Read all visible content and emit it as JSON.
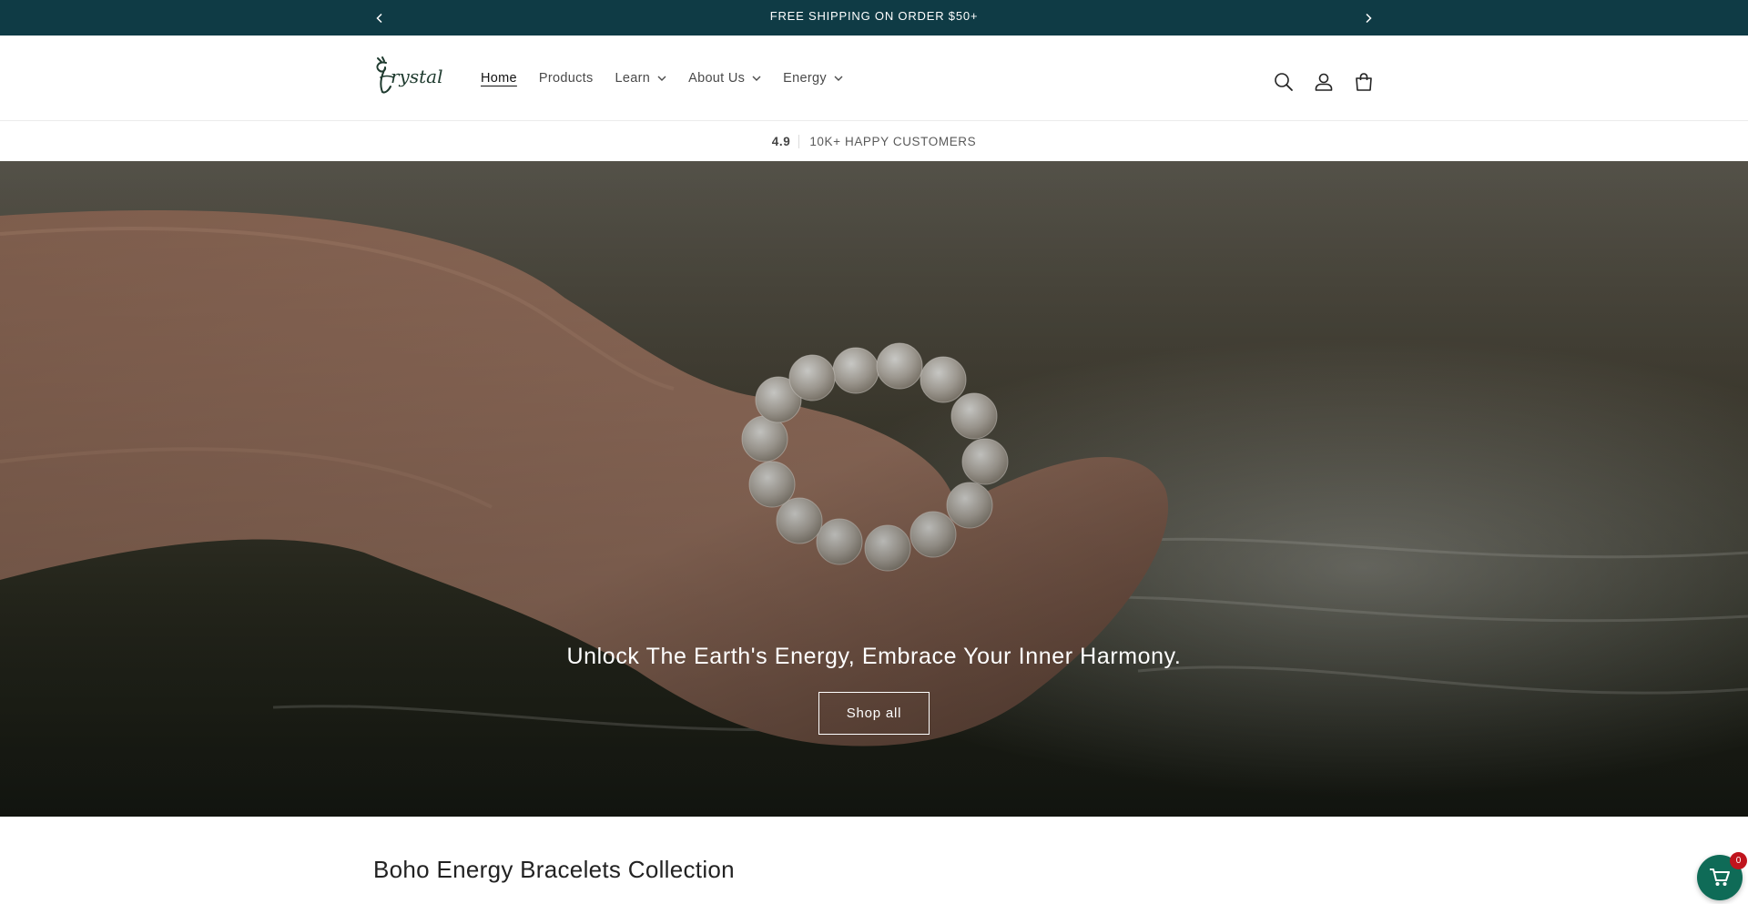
{
  "announcement": {
    "text": "FREE SHIPPING ON ORDER $50+",
    "prev_icon": "chevron-left-icon",
    "next_icon": "chevron-right-icon"
  },
  "header": {
    "logo_text": "Crystal",
    "nav": [
      {
        "label": "Home",
        "active": true,
        "dropdown": false
      },
      {
        "label": "Products",
        "active": false,
        "dropdown": false
      },
      {
        "label": "Learn",
        "active": false,
        "dropdown": true
      },
      {
        "label": "About Us",
        "active": false,
        "dropdown": true
      },
      {
        "label": "Energy",
        "active": false,
        "dropdown": true
      }
    ],
    "icons": [
      "search-icon",
      "account-icon",
      "cart-icon"
    ]
  },
  "rating": {
    "score": "4.9",
    "text": "10K+ HAPPY CUSTOMERS"
  },
  "hero": {
    "tagline": "Unlock The Earth's Energy, Embrace Your Inner Harmony.",
    "cta_label": "Shop all"
  },
  "collection": {
    "title": "Boho Energy Bracelets Collection"
  },
  "floating_cart": {
    "count": "0",
    "icon": "shopping-cart-icon"
  },
  "colors": {
    "announcement_bg": "#0f3b45",
    "floating_cart_bg": "#0f6b57",
    "badge_bg": "#c0141d"
  }
}
